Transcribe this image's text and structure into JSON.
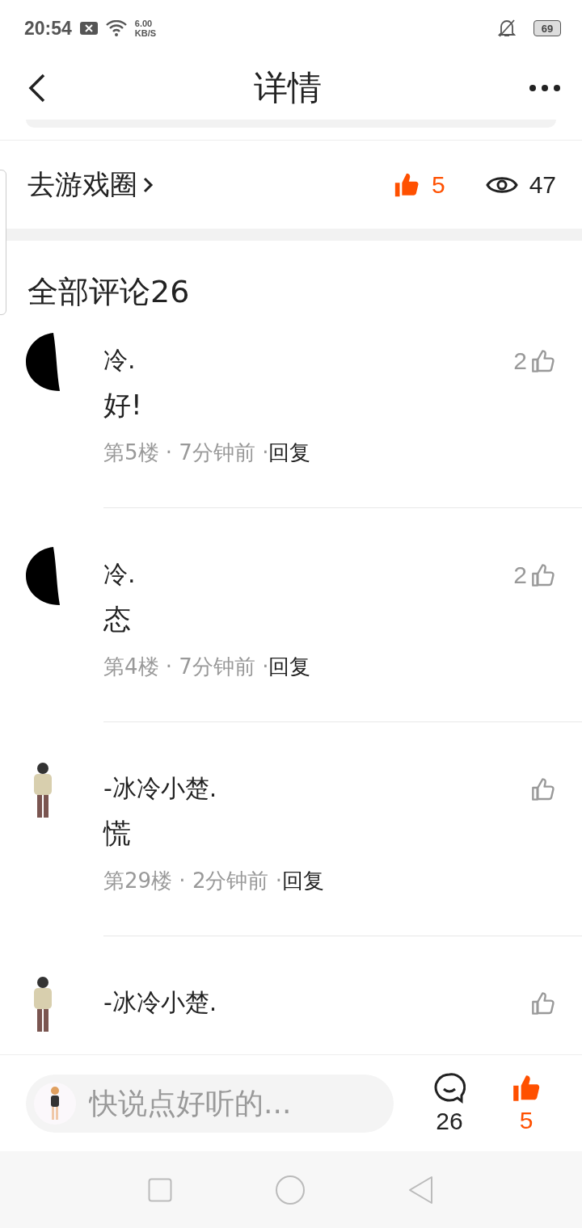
{
  "status_bar": {
    "time": "20:54",
    "speed_value": "6.00",
    "speed_unit": "KB/S",
    "battery": "69"
  },
  "header": {
    "title": "详情"
  },
  "post_bar": {
    "link": "去游戏圈",
    "like": {
      "count": "5",
      "liked": true
    },
    "views": "47"
  },
  "comments_title": "全部评论26",
  "comments": [
    {
      "name": "冷.",
      "text": "好!",
      "meta": "第5楼 · 7分钟前 ·",
      "reply": "回复",
      "likes": "2",
      "liked": false
    },
    {
      "name": "冷.",
      "text": "态",
      "meta": "第4楼 · 7分钟前 ·",
      "reply": "回复",
      "likes": "2",
      "liked": false
    },
    {
      "name": "-冰冷小楚.",
      "text": "慌",
      "meta": "第29楼 · 2分钟前 ·",
      "reply": "回复",
      "liked": false
    },
    {
      "name": "-冰冷小楚.",
      "liked": false
    }
  ],
  "bottom_bar": {
    "placeholder": "快说点好听的...",
    "comment_count": "26",
    "like": {
      "count": "5",
      "liked": true
    }
  }
}
